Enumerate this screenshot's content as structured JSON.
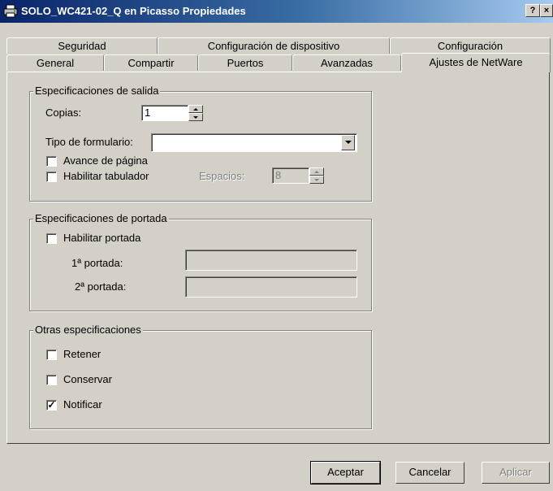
{
  "window": {
    "title": "SOLO_WC421-02_Q en Picasso Propiedades",
    "help_button": "?",
    "close_button": "×"
  },
  "tabs": {
    "back_row": [
      "Seguridad",
      "Configuración de dispositivo",
      "Configuración"
    ],
    "front_row": [
      "General",
      "Compartir",
      "Puertos",
      "Avanzadas",
      "Ajustes de NetWare"
    ],
    "active": "Ajustes de NetWare"
  },
  "output_settings": {
    "legend": "Especificaciones de salida",
    "copies_label": "Copias:",
    "copies_value": "1",
    "form_type_label": "Tipo de formulario:",
    "form_type_value": "",
    "form_feed_label": "Avance de página",
    "form_feed_checked": false,
    "enable_tabs_label": "Habilitar tabulador",
    "enable_tabs_checked": false,
    "spaces_label": "Espacios:",
    "spaces_value": "8"
  },
  "banner_settings": {
    "legend": "Especificaciones de portada",
    "enable_banner_label": "Habilitar portada",
    "enable_banner_checked": false,
    "banner1_label": "1ª portada:",
    "banner1_value": "",
    "banner2_label": "2ª portada:",
    "banner2_value": ""
  },
  "other_settings": {
    "legend": "Otras especificaciones",
    "hold_label": "Retener",
    "hold_checked": false,
    "keep_label": "Conservar",
    "keep_checked": false,
    "notify_label": "Notificar",
    "notify_checked": true
  },
  "buttons": {
    "ok": "Aceptar",
    "cancel": "Cancelar",
    "apply": "Aplicar"
  }
}
